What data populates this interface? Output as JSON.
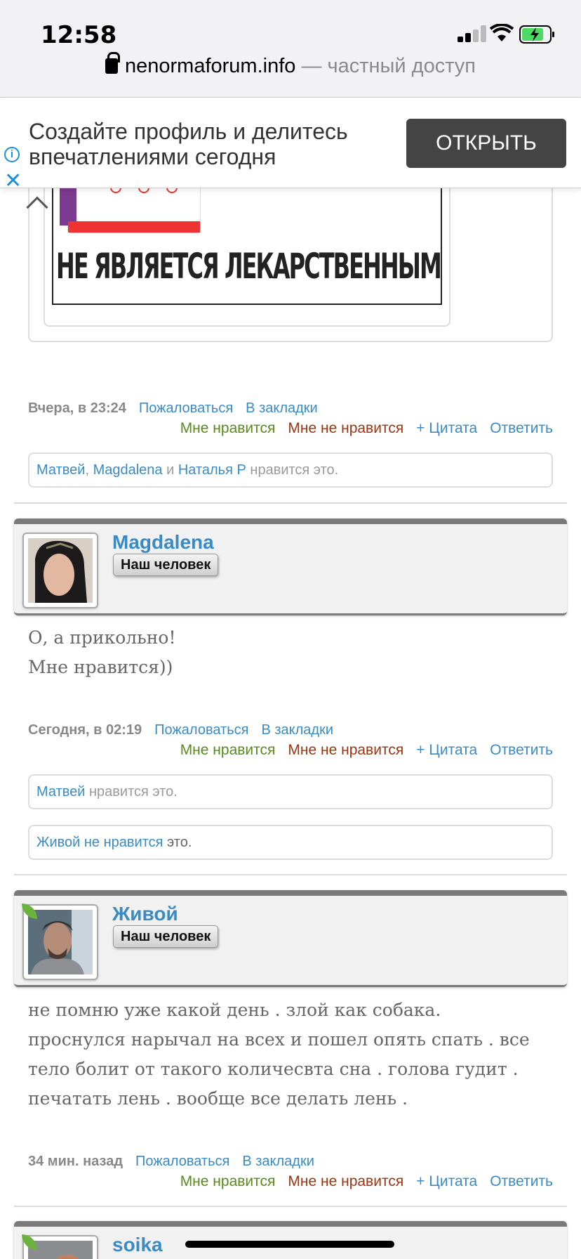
{
  "status_bar": {
    "time": "12:58"
  },
  "address_bar": {
    "host": "nenormaforum.info",
    "separator": " — ",
    "note": "частный доступ"
  },
  "ad_banner": {
    "line1": "Создайте профиль и делитесь",
    "line2": "впечатлениями сегодня",
    "button": "ОТКРЫТЬ",
    "info_glyph": "i",
    "close_glyph": "✕"
  },
  "ad_image": {
    "warning": "НЕ ЯВЛЯЕТСЯ ЛЕКАРСТВЕННЫМ СРЕДСТВОМ"
  },
  "actions": {
    "report": "Пожаловаться",
    "bookmark": "В закладки",
    "like": "Мне нравится",
    "dislike": "Мне не нравится",
    "quote": "+ Цитата",
    "reply": "Ответить"
  },
  "posts": [
    {
      "date": "Вчера, в 23:24",
      "likes": {
        "u1": "Матвей",
        "sep1": ", ",
        "u2": "Magdalena",
        "and": " и ",
        "u3": "Наталья Р",
        "suffix": " нравится это."
      }
    },
    {
      "author": "Magdalena",
      "badge": "Наш человек",
      "lines": [
        "О, а прикольно!",
        "Мне нравится))"
      ],
      "date": "Сегодня, в 02:19",
      "likes": {
        "u1": "Матвей",
        "suffix": " нравится это."
      },
      "dislikes": {
        "u1": "Живой не нравится",
        "suffix": " это."
      }
    },
    {
      "author": "Живой",
      "badge": "Наш человек",
      "lines": [
        "не помню уже какой день . злой как собака.",
        "проснулся нарычал на всех и пошел опять спать . все",
        "тело болит от такого количесвта сна . голова гудит .",
        "печатать лень . вообще все делать лень ."
      ],
      "date": "34 мин. назад"
    },
    {
      "author": "soika"
    }
  ]
}
